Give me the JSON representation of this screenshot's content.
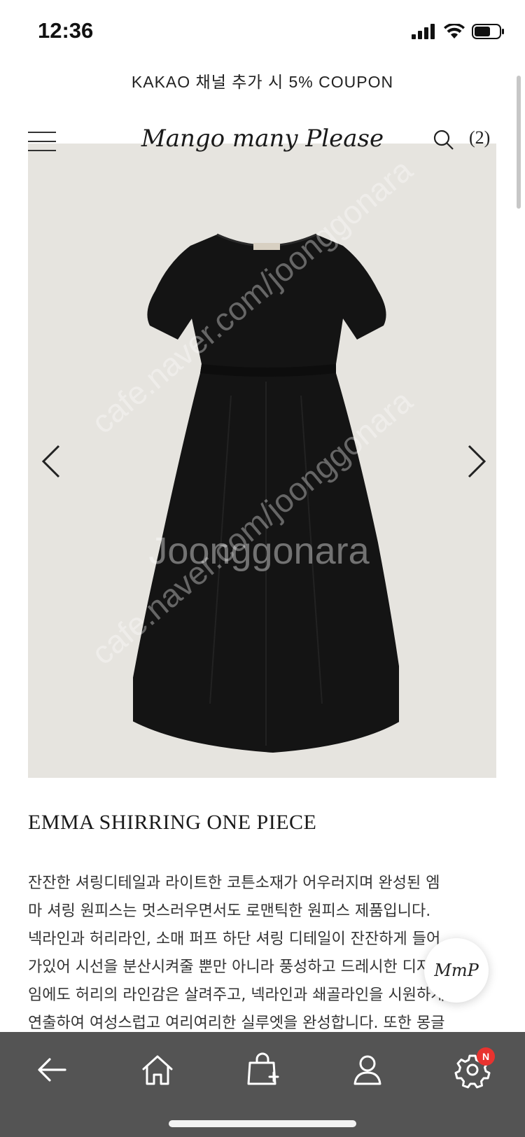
{
  "status_bar": {
    "time": "12:36"
  },
  "promo_banner": {
    "text": "KAKAO 채널 추가 시 5% COUPON"
  },
  "header": {
    "logo": "Mango many Please",
    "cart_count": "(2)"
  },
  "product": {
    "image_bg": "#e6e4df",
    "watermark": [
      "cafe.naver.com/joonggonara",
      "Joonggonara"
    ],
    "title": "EMMA SHIRRING ONE PIECE",
    "description_lines": [
      "잔잔한 셔링디테일과 라이트한 코튼소재가 어우러지며 완성된 엠",
      "마 셔링 원피스는 멋스러우면서도 로맨틱한 원피스 제품입니다.",
      "넥라인과 허리라인, 소매 퍼프 하단 셔링 디테일이 잔잔하게 들어",
      "가있어 시선을 분산시켜줄 뿐만 아니라 풍성하고 드레시한 디자인",
      "임에도 허리의 라인감은 살려주고, 넥라인과 쇄골라인을 시원하게",
      "연출하여 여성스럽고 여리여리한 실루엣을 완성합니다. 또한 몽글"
    ]
  },
  "floating_badge": {
    "label": "MmP"
  },
  "bottom_nav": {
    "background": "#545454",
    "items": [
      {
        "icon": "back-arrow-icon"
      },
      {
        "icon": "home-icon"
      },
      {
        "icon": "shopping-bag-add-icon"
      },
      {
        "icon": "user-icon"
      },
      {
        "icon": "settings-gear-icon",
        "badge": "N"
      }
    ]
  },
  "colors": {
    "notification_badge": "#e8332f"
  }
}
